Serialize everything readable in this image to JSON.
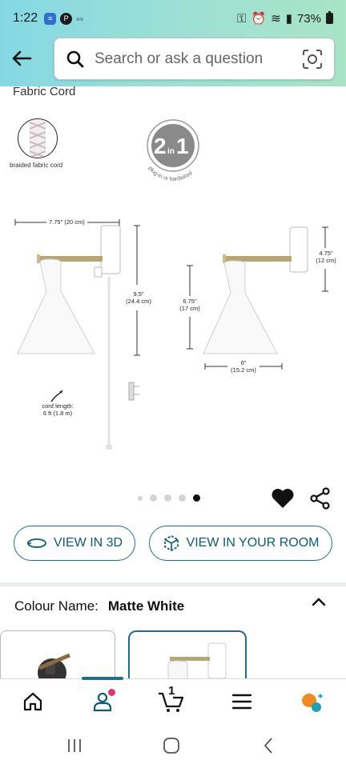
{
  "status_bar": {
    "time": "1:22",
    "battery": "73%"
  },
  "search": {
    "placeholder": "Search or ask a question"
  },
  "product_images": {
    "label": "Fabric Cord",
    "cord_caption": "braided fabric cord",
    "badge_main": "2",
    "badge_in": "in",
    "badge_one": "1",
    "badge_arc": "plug-in or hardwired",
    "dims": {
      "width_top": "7.75\" (20 cm)",
      "height_left_1": "9.5\"",
      "height_left_2": "(24.4 cm)",
      "cord_1": "cord length:",
      "cord_2": "6 ft (1.8 m)",
      "height_mid_1": "6.75\"",
      "height_mid_2": "(17 cm)",
      "plate_1": "4.75\"",
      "plate_2": "(12 cm)",
      "shade_1": "6\"",
      "shade_2": "(15.2 cm)"
    },
    "carousel": {
      "total": 5,
      "active_index": 4
    }
  },
  "actions": {
    "view_3d": "VIEW IN 3D",
    "view_room": "VIEW IN YOUR ROOM"
  },
  "colour": {
    "label": "Colour Name:",
    "value": "Matte White"
  },
  "bottom_nav": {
    "cart_count": "1",
    "items": [
      "home-icon",
      "profile-icon",
      "cart-icon",
      "menu-icon",
      "rufus-icon"
    ]
  },
  "colors": {
    "accent": "#1e6d8c",
    "header_start": "#84d8e4",
    "header_end": "#a8e4c6",
    "notification": "#e0366f",
    "rufus_orange": "#f08a24",
    "rufus_teal": "#1aa1b8"
  }
}
